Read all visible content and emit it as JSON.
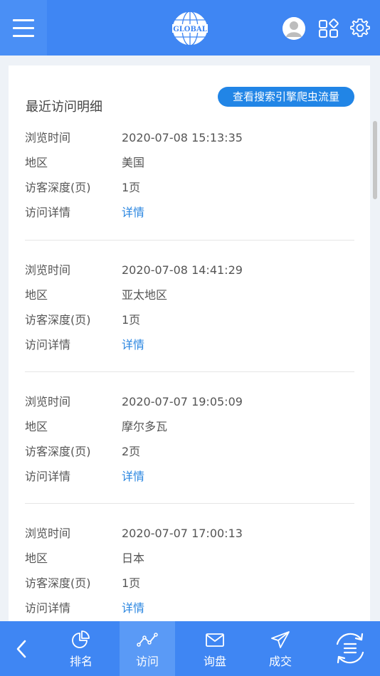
{
  "header": {
    "logo_text": "GLOBAL",
    "icons": [
      "menu-icon",
      "globe-logo",
      "avatar",
      "apps-icon",
      "gear-icon"
    ]
  },
  "page": {
    "title": "最近访问明细",
    "crawler_button": "查看搜索引擎爬虫流量"
  },
  "labels": {
    "time": "浏览时间",
    "region": "地区",
    "depth": "访客深度(页)",
    "details": "访问详情"
  },
  "records": [
    {
      "time": "2020-07-08 15:13:35",
      "region": "美国",
      "depth": "1页",
      "details": "详情"
    },
    {
      "time": "2020-07-08 14:41:29",
      "region": "亚太地区",
      "depth": "1页",
      "details": "详情"
    },
    {
      "time": "2020-07-07 19:05:09",
      "region": "摩尔多瓦",
      "depth": "2页",
      "details": "详情"
    },
    {
      "time": "2020-07-07 17:00:13",
      "region": "日本",
      "depth": "1页",
      "details": "详情"
    }
  ],
  "bottom_nav": {
    "items": [
      {
        "label": "排名",
        "icon": "pie-chart-icon"
      },
      {
        "label": "访问",
        "icon": "line-trend-icon"
      },
      {
        "label": "询盘",
        "icon": "mail-icon"
      },
      {
        "label": "成交",
        "icon": "send-icon"
      }
    ],
    "active_index": 1
  },
  "colors": {
    "header_bg": "#3f86f3",
    "accent": "#2185e6",
    "link": "#2a86e0",
    "content_bg": "#eef2f7"
  }
}
